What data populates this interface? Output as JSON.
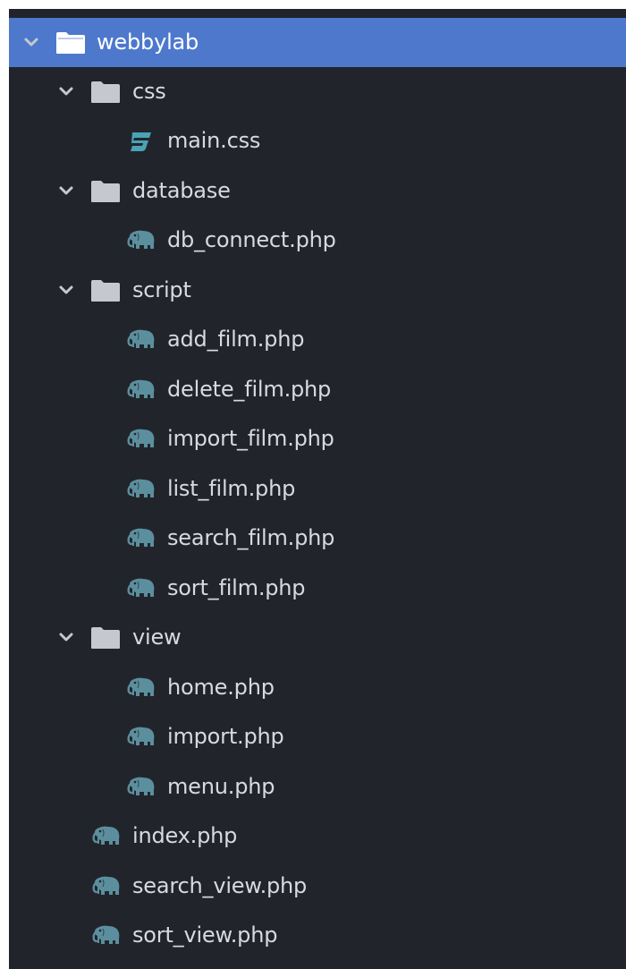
{
  "colors": {
    "panel_bg": "#21252b",
    "selected_bg": "#4d78cc",
    "label_color": "#d7dae0",
    "folder_color": "#c5c8ce",
    "php_icon_color": "#5c8f9e",
    "css_icon_color": "#4aa3b5"
  },
  "tree": {
    "root": {
      "label": "webbylab",
      "icon": "folder-open-icon",
      "expanded": true,
      "selected": true
    },
    "css_folder": {
      "label": "css",
      "icon": "folder-icon",
      "expanded": true
    },
    "main_css": {
      "label": "main.css",
      "icon": "css3-icon"
    },
    "database_folder": {
      "label": "database",
      "icon": "folder-icon",
      "expanded": true
    },
    "db_connect": {
      "label": "db_connect.php",
      "icon": "php-elephant-icon"
    },
    "script_folder": {
      "label": "script",
      "icon": "folder-icon",
      "expanded": true
    },
    "add_film": {
      "label": "add_film.php",
      "icon": "php-elephant-icon"
    },
    "delete_film": {
      "label": "delete_film.php",
      "icon": "php-elephant-icon"
    },
    "import_film": {
      "label": "import_film.php",
      "icon": "php-elephant-icon"
    },
    "list_film": {
      "label": "list_film.php",
      "icon": "php-elephant-icon"
    },
    "search_film": {
      "label": "search_film.php",
      "icon": "php-elephant-icon"
    },
    "sort_film": {
      "label": "sort_film.php",
      "icon": "php-elephant-icon"
    },
    "view_folder": {
      "label": "view",
      "icon": "folder-icon",
      "expanded": true
    },
    "home": {
      "label": "home.php",
      "icon": "php-elephant-icon"
    },
    "import": {
      "label": "import.php",
      "icon": "php-elephant-icon"
    },
    "menu": {
      "label": "menu.php",
      "icon": "php-elephant-icon"
    },
    "index": {
      "label": "index.php",
      "icon": "php-elephant-icon"
    },
    "search_view": {
      "label": "search_view.php",
      "icon": "php-elephant-icon"
    },
    "sort_view": {
      "label": "sort_view.php",
      "icon": "php-elephant-icon"
    }
  }
}
